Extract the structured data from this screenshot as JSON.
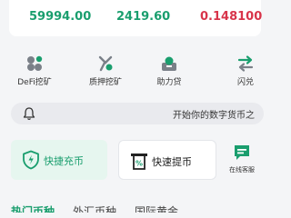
{
  "prices": [
    {
      "value": "59994.00",
      "color": "#1a9e6e"
    },
    {
      "value": "2419.60",
      "color": "#1a9e6e"
    },
    {
      "value": "0.148100",
      "color": "#d8344a"
    }
  ],
  "menu": [
    {
      "label": "DeFi挖矿",
      "icon": "defi-mining-icon"
    },
    {
      "label": "质押挖矿",
      "icon": "staking-mining-icon"
    },
    {
      "label": "助力贷",
      "icon": "loan-icon"
    },
    {
      "label": "闪兑",
      "icon": "swap-icon"
    }
  ],
  "notice": {
    "text": "开始你的数字货币之",
    "icon": "bell-icon"
  },
  "actions": {
    "recharge": "快捷充币",
    "withdraw": "快速提币",
    "service": "在线客服"
  },
  "tabs": [
    "热门币种",
    "外汇币种",
    "国际黄金"
  ],
  "colors": {
    "accent": "#1a9e6e",
    "down": "#d8344a",
    "background": "#f4f5f7"
  }
}
